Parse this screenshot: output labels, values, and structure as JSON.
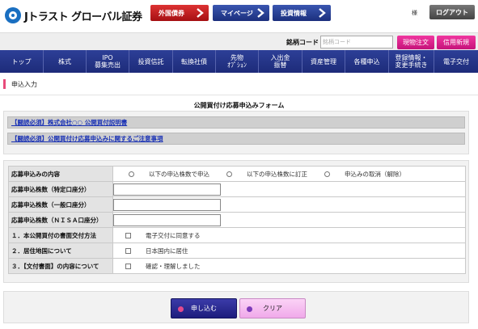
{
  "header": {
    "brand": "Jトラスト グローバル証券",
    "buttons": [
      {
        "label": "外国債券",
        "icon": "chevron-right-icon"
      },
      {
        "label": "マイページ",
        "icon": "chevron-right-icon"
      },
      {
        "label": "投資情報",
        "icon": "chevron-right-icon"
      }
    ],
    "user_suffix": "様",
    "logout_label": "ログアウト"
  },
  "search": {
    "label": "銘柄コード",
    "placeholder": "銘柄コード",
    "cash_order_label": "現物注文",
    "margin_new_label": "信用新規"
  },
  "nav": {
    "items": [
      {
        "label": "トップ"
      },
      {
        "label": "株式"
      },
      {
        "label": "IPO\n募集売出"
      },
      {
        "label": "投資信託"
      },
      {
        "label": "転換社債"
      },
      {
        "label": "先物\nｵﾌﾟｼｮﾝ"
      },
      {
        "label": "入出金\n振替"
      },
      {
        "label": "資産管理"
      },
      {
        "label": "各種申込"
      },
      {
        "label": "登録情報・\n変更手続き"
      },
      {
        "label": "電子交付"
      }
    ]
  },
  "section": {
    "title": "申込入力",
    "form_title": "公開買付け応募申込みフォーム"
  },
  "notices": [
    "【闘読必須】株式会社○○ 公開買付説明書",
    "【闘読必須】公開買付け応募申込みに関するご注意事項"
  ],
  "form": {
    "rows": [
      {
        "label": "応募申込みの内容"
      },
      {
        "label": "応募申込株数（特定口座分）"
      },
      {
        "label": "応募申込株数（一般口座分）"
      },
      {
        "label": "応募申込株数（ＮＩＳＡ口座分）"
      },
      {
        "label": "１．本公開買付の書面交付方法"
      },
      {
        "label": "２．居住地国について"
      },
      {
        "label": "３．【文付書面】の内容について"
      }
    ],
    "radio_options": [
      "以下の申込株数で申込",
      "以下の申込株数に訂正",
      "申込みの取消（解除）"
    ],
    "check_labels": [
      "電子交付に同意する",
      "日本国内に居住",
      "確認・理解しました"
    ]
  },
  "actions": {
    "submit_label": "申し込む",
    "clear_label": "クリア"
  },
  "colors": {
    "nav_bg": "#1d2b79",
    "red_button": "#a50f12",
    "pink_button": "#c5137a",
    "accent_bar": "#e84b7b"
  }
}
